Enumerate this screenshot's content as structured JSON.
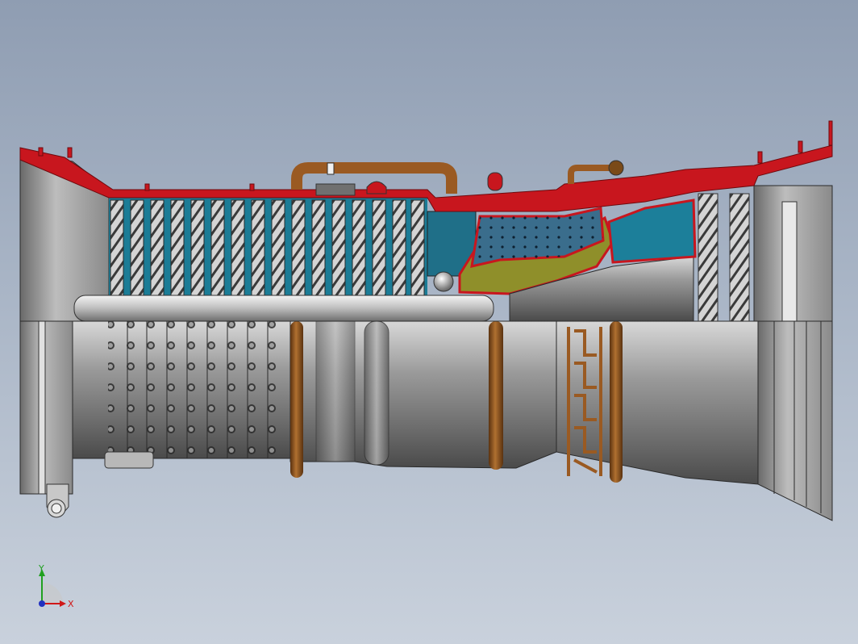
{
  "viewport": {
    "model": "gas-turbine-engine-section",
    "background_top": "#8f9db2",
    "background_bottom": "#c9d1dc"
  },
  "colors": {
    "casing_red": "#c8161e",
    "compressor_blade_teal": "#1c7f9a",
    "metal_grey": "#8c8c8c",
    "metal_dark": "#505050",
    "combustor_olive": "#8f8f2a",
    "combustor_blue": "#3a6d8c",
    "pipe_copper": "#9a5a22"
  },
  "triad": {
    "x_label": "X",
    "y_label": "Y",
    "x_color": "#d01818",
    "y_color": "#20a020",
    "z_color": "#2030c0"
  }
}
